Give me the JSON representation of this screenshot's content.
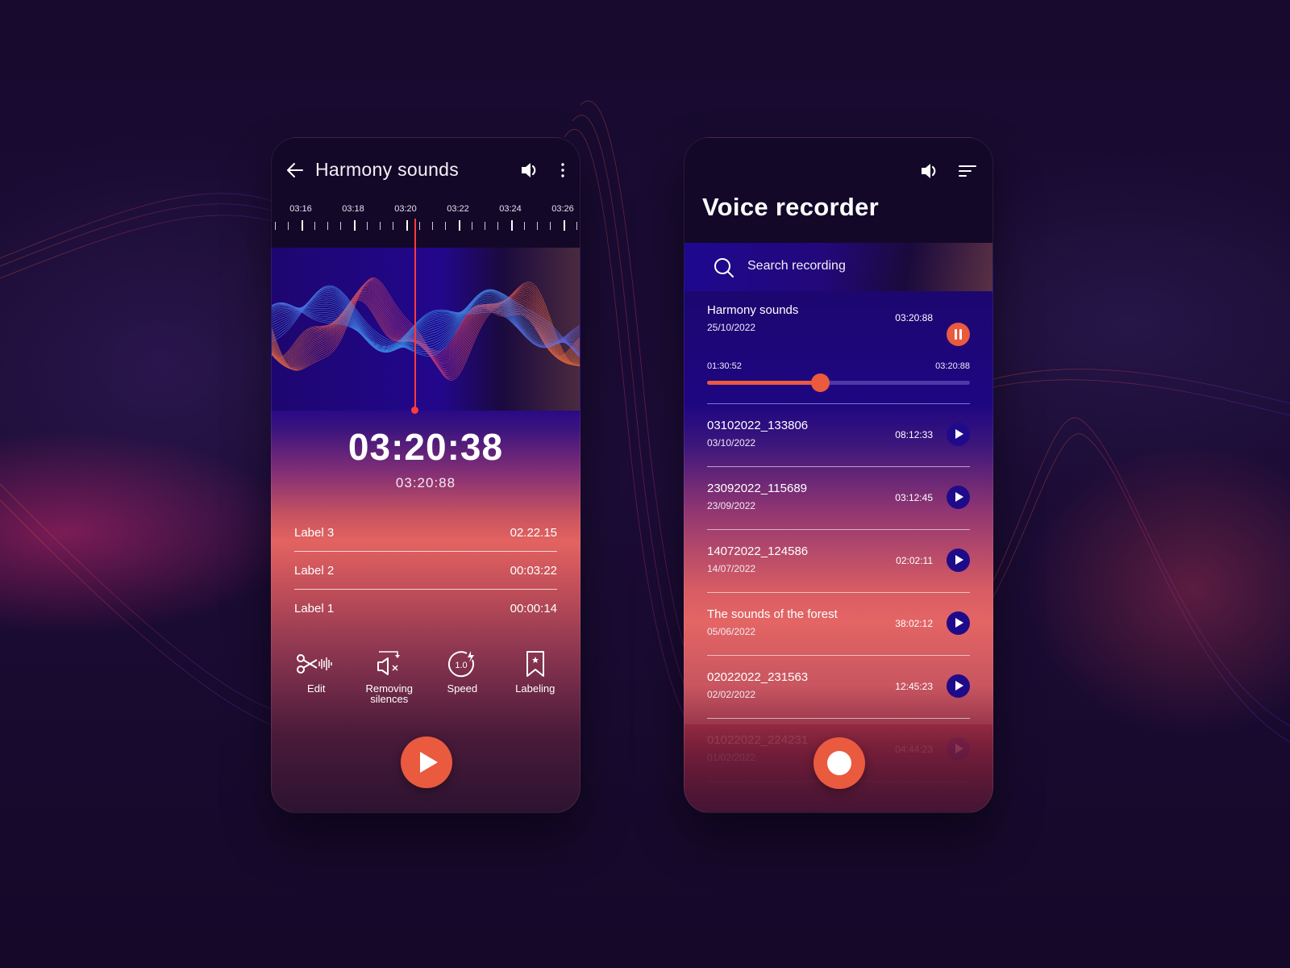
{
  "colors": {
    "accent": "#ea5a3e",
    "playhead": "#ff3b3b",
    "primary_dark": "#1f0b8a",
    "background": "#150829"
  },
  "player": {
    "title": "Harmony sounds",
    "back_icon": "arrow-left-icon",
    "volume_icon": "volume-icon",
    "more_icon": "more-vertical-icon",
    "timeline_labels": [
      "03:16",
      "03:18",
      "03:20",
      "03:22",
      "03:24",
      "03:26"
    ],
    "current_time": "03:20:38",
    "total_time": "03:20:88",
    "labels": [
      {
        "name": "Label 3",
        "time": "02.22.15"
      },
      {
        "name": "Label 2",
        "time": "00:03:22"
      },
      {
        "name": "Label 1",
        "time": "00:00:14"
      }
    ],
    "tools": [
      {
        "label": "Edit",
        "icon": "scissors-waveform-icon"
      },
      {
        "label": "Removing silences",
        "icon": "mute-speaker-icon"
      },
      {
        "label": "Speed",
        "icon": "speed-1x-icon",
        "value": "1.0"
      },
      {
        "label": "Labeling",
        "icon": "bookmark-star-icon"
      }
    ],
    "play_icon": "play-icon"
  },
  "recorder": {
    "title": "Voice recorder",
    "volume_icon": "volume-icon",
    "filter_icon": "sort-filter-icon",
    "search": {
      "placeholder": "Search recording"
    },
    "active": {
      "name": "Harmony sounds",
      "date": "25/10/2022",
      "duration": "03:20:88",
      "position": "01:30:52",
      "end": "03:20:88",
      "progress_fraction": 0.43
    },
    "recordings": [
      {
        "name": "03102022_133806",
        "date": "03/10/2022",
        "duration": "08:12:33"
      },
      {
        "name": "23092022_115689",
        "date": "23/09/2022",
        "duration": "03:12:45"
      },
      {
        "name": "14072022_124586",
        "date": "14/07/2022",
        "duration": "02:02:11"
      },
      {
        "name": "The sounds of the forest",
        "date": "05/06/2022",
        "duration": "38:02:12"
      },
      {
        "name": "02022022_231563",
        "date": "02/02/2022",
        "duration": "12:45:23"
      },
      {
        "name": "01022022_224231",
        "date": "01/02/2022",
        "duration": "04:44:23"
      }
    ],
    "record_icon": "record-icon"
  }
}
